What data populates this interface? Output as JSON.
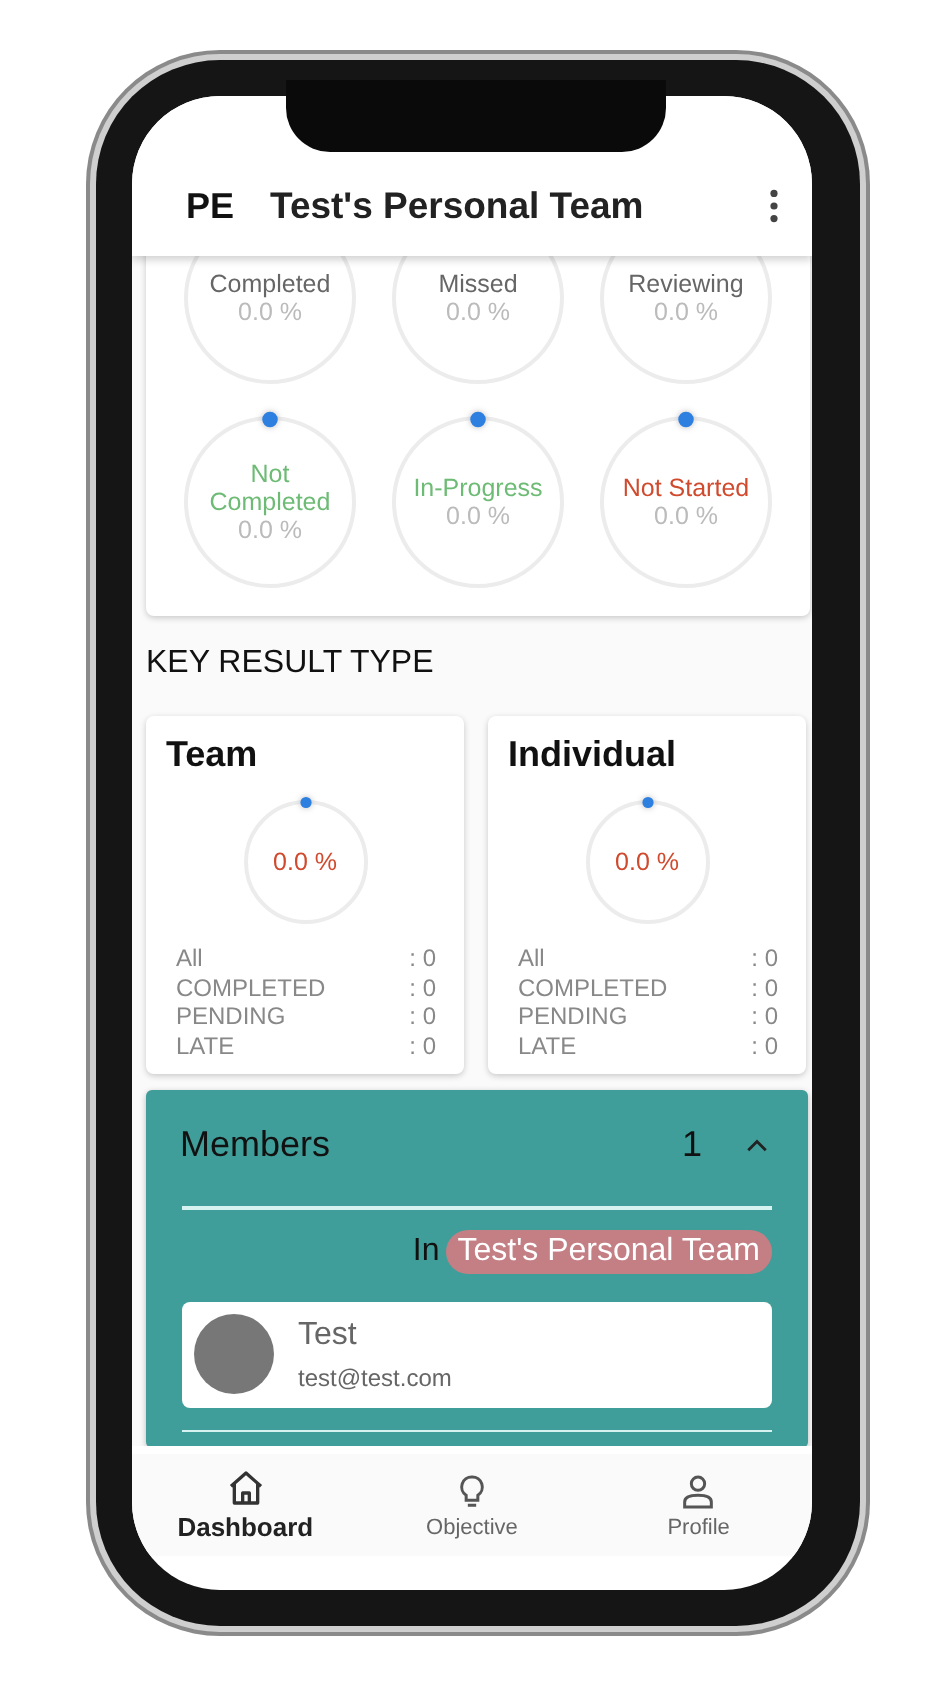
{
  "app_bar": {
    "logo": "PE",
    "title": "Test's Personal Team"
  },
  "status_circles": [
    {
      "label": "Completed",
      "value": "0.0 %",
      "color": "#666666"
    },
    {
      "label": "Missed",
      "value": "0.0 %",
      "color": "#666666"
    },
    {
      "label": "Reviewing",
      "value": "0.0 %",
      "color": "#666666"
    },
    {
      "label": "Not Completed",
      "value": "0.0 %",
      "color": "#6dbb74",
      "level": 0
    },
    {
      "label": "In-Progress",
      "value": "0.0 %",
      "color": "#6dbb74",
      "level": 0
    },
    {
      "label": "Not Started",
      "value": "0.0 %",
      "color": "#d04a2e",
      "level": 0
    }
  ],
  "key_result_type": {
    "heading": "KEY RESULT TYPE",
    "cards": [
      {
        "title": "Team",
        "value": "0.0 %",
        "level": 0,
        "stats": [
          {
            "label": "All",
            "value": ": 0"
          },
          {
            "label": "COMPLETED",
            "value": ": 0"
          },
          {
            "label": "PENDING",
            "value": ": 0"
          },
          {
            "label": "LATE",
            "value": ": 0"
          }
        ]
      },
      {
        "title": "Individual",
        "value": "0.0 %",
        "level": 0,
        "stats": [
          {
            "label": "All",
            "value": ": 0"
          },
          {
            "label": "COMPLETED",
            "value": ": 0"
          },
          {
            "label": "PENDING",
            "value": ": 0"
          },
          {
            "label": "LATE",
            "value": ": 0"
          }
        ]
      }
    ]
  },
  "members": {
    "title": "Members",
    "count": "1",
    "expanded": true,
    "in_label": "In",
    "team": "Test's Personal Team",
    "list": [
      {
        "name": "Test",
        "email": "test@test.com"
      }
    ]
  },
  "bottom_nav": [
    {
      "label": "Dashboard",
      "selected": true
    },
    {
      "label": "Objective",
      "selected": false
    },
    {
      "label": "Profile",
      "selected": false
    }
  ]
}
